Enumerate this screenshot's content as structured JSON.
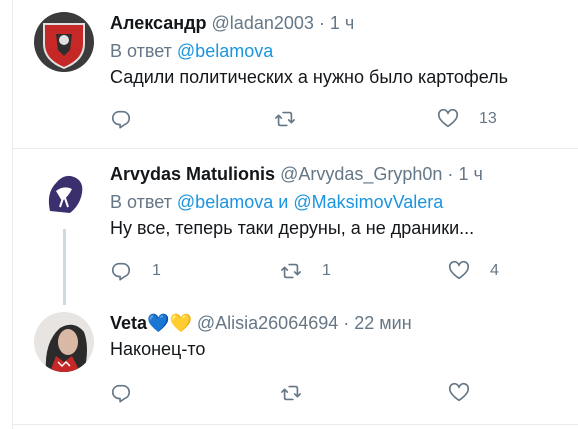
{
  "tweets": [
    {
      "name": "Александр",
      "handle": "@ladan2003",
      "separator": "·",
      "time": "1 ч",
      "reply_prefix": "В ответ",
      "reply_mention_1": "@belamova",
      "reply_connector": "",
      "reply_mention_2": "",
      "text": "Садили политических а нужно было картофель",
      "reply_count": "",
      "retweet_count": "",
      "like_count": "13"
    },
    {
      "name": "Arvydas Matulionis",
      "handle": "@Arvydas_Gryph0n",
      "separator": "·",
      "time": "1 ч",
      "reply_prefix": "В ответ",
      "reply_mention_1": "@belamova",
      "reply_connector": "и",
      "reply_mention_2": "@MaksimovValera",
      "text": "Ну все, теперь таки деруны, а не драники...",
      "reply_count": "1",
      "retweet_count": "1",
      "like_count": "4"
    },
    {
      "name": "Veta",
      "name_emoji": "💙💛",
      "handle": "@Alisia26064694",
      "separator": "·",
      "time": "22 мин",
      "text": "Наконец-то",
      "reply_count": "",
      "retweet_count": "",
      "like_count": ""
    }
  ],
  "colors": {
    "text": "#14171a",
    "secondary": "#657786",
    "link": "#1b95e0",
    "border": "#e6ecf0",
    "thread_line": "#cfd9de"
  },
  "icons": {
    "reply": "reply-icon",
    "retweet": "retweet-icon",
    "like": "heart-icon"
  }
}
